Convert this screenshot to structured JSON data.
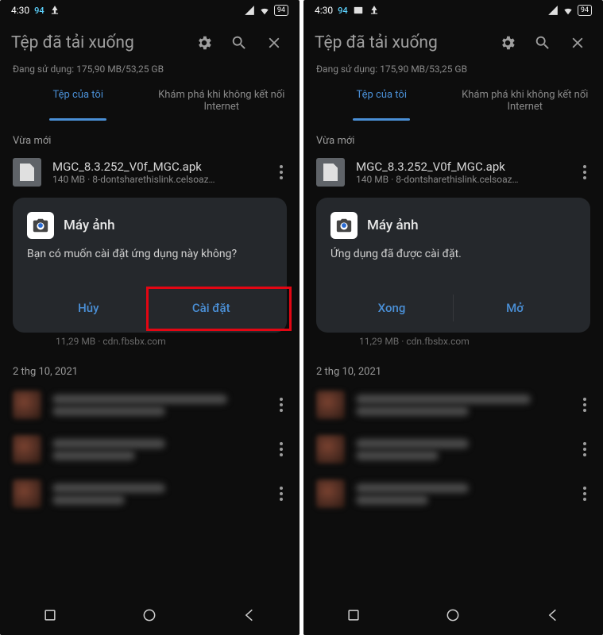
{
  "statusbar": {
    "time": "4:30",
    "notif_num": "94",
    "battery": "94"
  },
  "header": {
    "title": "Tệp đã tải xuống"
  },
  "storage_line": "Đang sử dụng: 175,90 MB/53,25 GB",
  "tabs": {
    "mine": "Tệp của tôi",
    "explore": "Khám phá khi không kết nối Internet"
  },
  "section_recent": "Vừa mới",
  "file": {
    "name": "MGC_8.3.252_V0f_MGC.apk",
    "meta": "140 MB · 8-dontsharethislink.celsoaz…"
  },
  "hidden_meta": "11,29 MB · cdn.fbsbx.com",
  "section_date": "2 thg 10, 2021",
  "dialog_left": {
    "title": "Máy ảnh",
    "body": "Bạn có muốn cài đặt ứng dụng này không?",
    "cancel": "Hủy",
    "install": "Cài đặt"
  },
  "dialog_right": {
    "title": "Máy ảnh",
    "body": "Ứng dụng đã được cài đặt.",
    "done": "Xong",
    "open": "Mở"
  }
}
